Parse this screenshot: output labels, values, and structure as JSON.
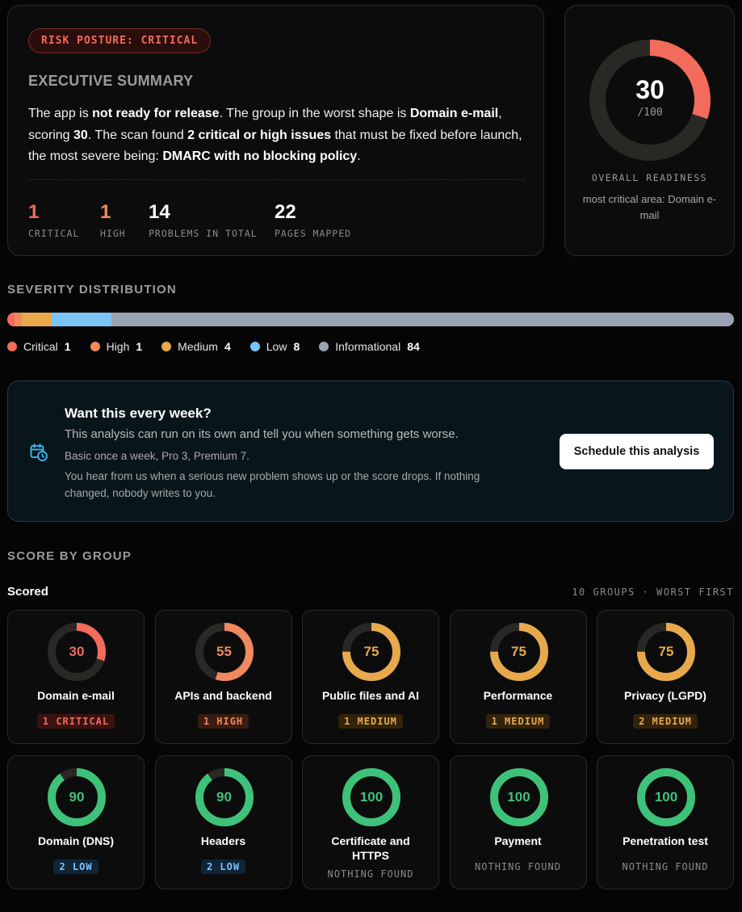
{
  "summary": {
    "risk_badge": "RISK POSTURE: CRITICAL",
    "heading": "EXECUTIVE SUMMARY",
    "text_parts": [
      "The app is ",
      "not ready for release",
      ". The group in the worst shape is ",
      "Domain e-mail",
      ",",
      " scoring ",
      "30",
      ". The scan found ",
      "2 critical or high issues",
      " that must be fixed before launch,",
      " the most severe being: ",
      "DMARC with no blocking policy",
      "."
    ],
    "stats": {
      "critical": {
        "value": "1",
        "label": "CRITICAL"
      },
      "high": {
        "value": "1",
        "label": "HIGH"
      },
      "total": {
        "value": "14",
        "label": "PROBLEMS IN TOTAL"
      },
      "pages": {
        "value": "22",
        "label": "PAGES MAPPED"
      }
    }
  },
  "readiness": {
    "score": 30,
    "score_text": "30",
    "max_text": "/100",
    "label": "OVERALL READINESS",
    "sub": "most critical area: Domain e-mail",
    "color": "#f26b5b"
  },
  "severity": {
    "heading": "SEVERITY DISTRIBUTION",
    "items": [
      {
        "name": "Critical",
        "count": 1,
        "color": "#f26b5b"
      },
      {
        "name": "High",
        "count": 1,
        "color": "#f0895e"
      },
      {
        "name": "Medium",
        "count": 4,
        "color": "#e8a94c"
      },
      {
        "name": "Low",
        "count": 8,
        "color": "#7cc4f8"
      },
      {
        "name": "Informational",
        "count": 84,
        "color": "#9aa3b2"
      }
    ]
  },
  "schedule": {
    "title": "Want this every week?",
    "text1": "This analysis can run on its own and tell you when something gets worse.",
    "text2": "Basic once a week, Pro 3, Premium 7.",
    "text3": "You hear from us when a serious new problem shows up or the score drops. If nothing changed, nobody writes to you.",
    "button": "Schedule this analysis",
    "icon": "calendar-clock-icon"
  },
  "groups": {
    "heading": "SCORE BY GROUP",
    "scored_label": "Scored",
    "meta": "10 GROUPS · WORST FIRST",
    "items": [
      {
        "name": "Domain e-mail",
        "score": 30,
        "badge": "1 CRITICAL",
        "level": "critical",
        "color": "#f26b5b"
      },
      {
        "name": "APIs and backend",
        "score": 55,
        "badge": "1 HIGH",
        "level": "high",
        "color": "#f0895e"
      },
      {
        "name": "Public files and AI",
        "score": 75,
        "badge": "1 MEDIUM",
        "level": "medium",
        "color": "#e8a94c"
      },
      {
        "name": "Performance",
        "score": 75,
        "badge": "1 MEDIUM",
        "level": "medium",
        "color": "#e8a94c"
      },
      {
        "name": "Privacy (LGPD)",
        "score": 75,
        "badge": "2 MEDIUM",
        "level": "medium",
        "color": "#e8a94c"
      },
      {
        "name": "Domain (DNS)",
        "score": 90,
        "badge": "2 LOW",
        "level": "low",
        "color": "#3ec27a"
      },
      {
        "name": "Headers",
        "score": 90,
        "badge": "2 LOW",
        "level": "low",
        "color": "#3ec27a"
      },
      {
        "name": "Certificate and HTTPS",
        "score": 100,
        "badge": "NOTHING FOUND",
        "level": "none",
        "color": "#3ec27a"
      },
      {
        "name": "Payment",
        "score": 100,
        "badge": "NOTHING FOUND",
        "level": "none",
        "color": "#3ec27a"
      },
      {
        "name": "Penetration test",
        "score": 100,
        "badge": "NOTHING FOUND",
        "level": "none",
        "color": "#3ec27a"
      }
    ]
  }
}
